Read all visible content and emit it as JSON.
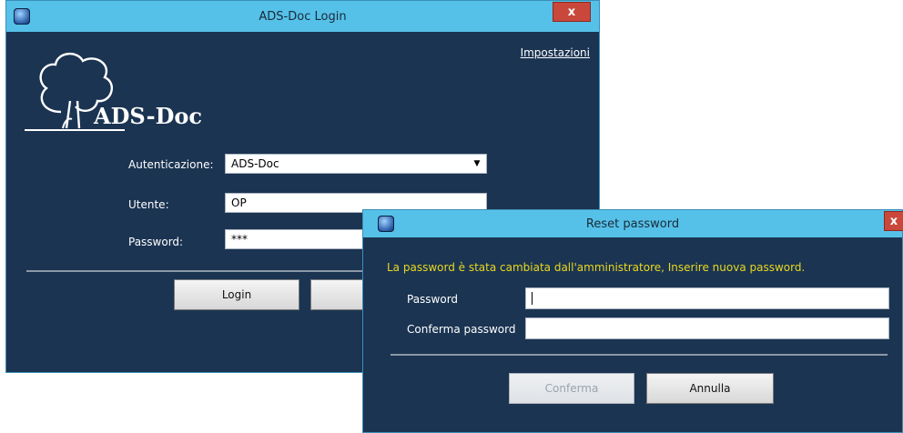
{
  "login": {
    "title": "ADS-Doc Login",
    "close_label": "x",
    "settings_link": "Impostazioni",
    "logo_text": "ADS-Doc",
    "auth_label": "Autenticazione:",
    "auth_value": "ADS-Doc",
    "user_label": "Utente:",
    "user_value": "OP",
    "password_label": "Password:",
    "password_value": "***",
    "login_button": "Login"
  },
  "reset": {
    "title": "Reset password",
    "close_label": "x",
    "message": "La password è stata cambiata dall'amministratore, Inserire nuova password.",
    "password_label": "Password",
    "confirm_label": "Conferma password",
    "confirm_button": "Conferma",
    "cancel_button": "Annulla"
  },
  "colors": {
    "window_bg": "#1b3452",
    "titlebar": "#56c1e8",
    "message": "#e8d820"
  }
}
